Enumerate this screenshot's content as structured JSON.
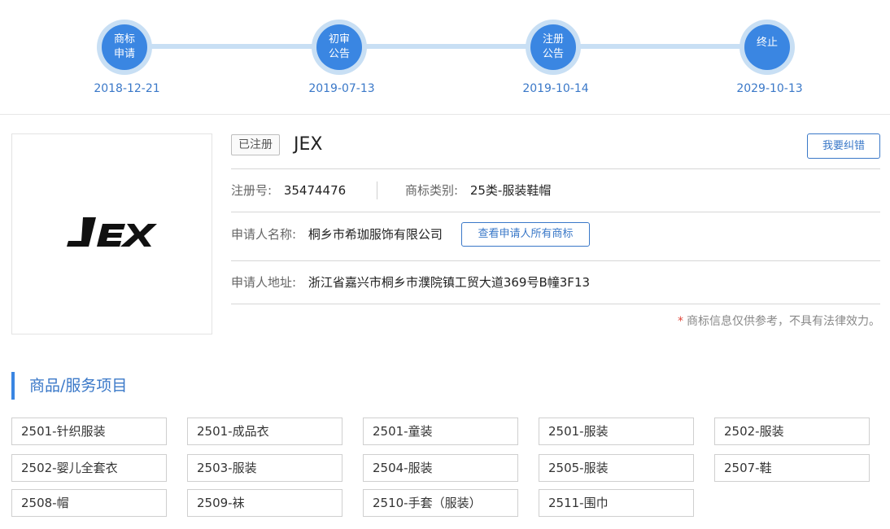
{
  "timeline": [
    {
      "label": "商标申请",
      "line1": "商标",
      "line2": "申请",
      "date": "2018-12-21"
    },
    {
      "label": "初审公告",
      "line1": "初审",
      "line2": "公告",
      "date": "2019-07-13"
    },
    {
      "label": "注册公告",
      "line1": "注册",
      "line2": "公告",
      "date": "2019-10-14"
    },
    {
      "label": "终止",
      "line1": "终止",
      "line2": "",
      "date": "2029-10-13"
    }
  ],
  "trademark": {
    "logo_text": "JEX",
    "status": "已注册",
    "name": "JEX",
    "correct_label": "我要纠错",
    "reg_no_label": "注册号:",
    "reg_no": "35474476",
    "class_label": "商标类别:",
    "class_value": "25类-服装鞋帽",
    "applicant_label": "申请人名称:",
    "applicant": "桐乡市希珈服饰有限公司",
    "view_all_label": "查看申请人所有商标",
    "address_label": "申请人地址:",
    "address": "浙江省嘉兴市桐乡市濮院镇工贸大道369号B幢3F13",
    "disclaimer_star": "*",
    "disclaimer": "商标信息仅供参考，不具有法律效力。"
  },
  "goods_section": {
    "title": "商品/服务项目",
    "items": [
      "2501-针织服装",
      "2501-成品衣",
      "2501-童装",
      "2501-服装",
      "2502-服装",
      "2502-婴儿全套衣",
      "2503-服装",
      "2504-服装",
      "2505-服装",
      "2507-鞋",
      "2508-帽",
      "2509-袜",
      "2510-手套（服装）",
      "2511-围巾"
    ]
  },
  "colors": {
    "accent": "#3a86e2",
    "link": "#3a78c8",
    "timeline_track": "#c8dff4",
    "asterisk": "#e0463a"
  }
}
